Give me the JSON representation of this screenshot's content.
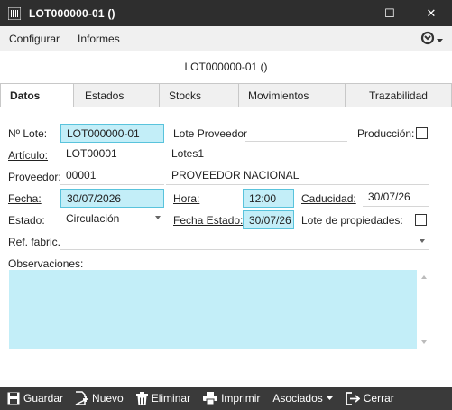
{
  "window": {
    "title": "LOT000000-01 ()",
    "minimize": "—",
    "maximize": "☐",
    "close": "✕"
  },
  "menu": {
    "configurar": "Configurar",
    "informes": "Informes"
  },
  "header": {
    "title": "LOT000000-01 ()"
  },
  "tabs": {
    "datos": "Datos",
    "estados": "Estados",
    "stocks": "Stocks",
    "movimientos": "Movimientos",
    "trazabilidad": "Trazabilidad"
  },
  "form": {
    "no_lote_label": "Nº Lote:",
    "no_lote_value": "LOT000000-01",
    "lote_proveedor_label": "Lote Proveedor",
    "lote_proveedor_value": "",
    "produccion_label": "Producción:",
    "articulo_label": "Artículo:",
    "articulo_code": "LOT00001",
    "articulo_name": "Lotes1",
    "proveedor_label": "Proveedor:",
    "proveedor_code": "00001",
    "proveedor_name": "PROVEEDOR NACIONAL",
    "fecha_label": "Fecha:",
    "fecha_value": "30/07/2026",
    "hora_label": "Hora:",
    "hora_value": "12:00",
    "caducidad_label": "Caducidad:",
    "caducidad_value": "30/07/26",
    "estado_label": "Estado:",
    "estado_value": "Circulación",
    "fecha_estado_label": "Fecha Estado:",
    "fecha_estado_value": "30/07/26",
    "lote_propiedades_label": "Lote de propiedades:",
    "ref_fabric_label": "Ref. fabric.",
    "observaciones_label": "Observaciones:"
  },
  "toolbar": {
    "guardar": "Guardar",
    "nuevo": "Nuevo",
    "eliminar": "Eliminar",
    "imprimir": "Imprimir",
    "asociados": "Asociados",
    "cerrar": "Cerrar"
  }
}
